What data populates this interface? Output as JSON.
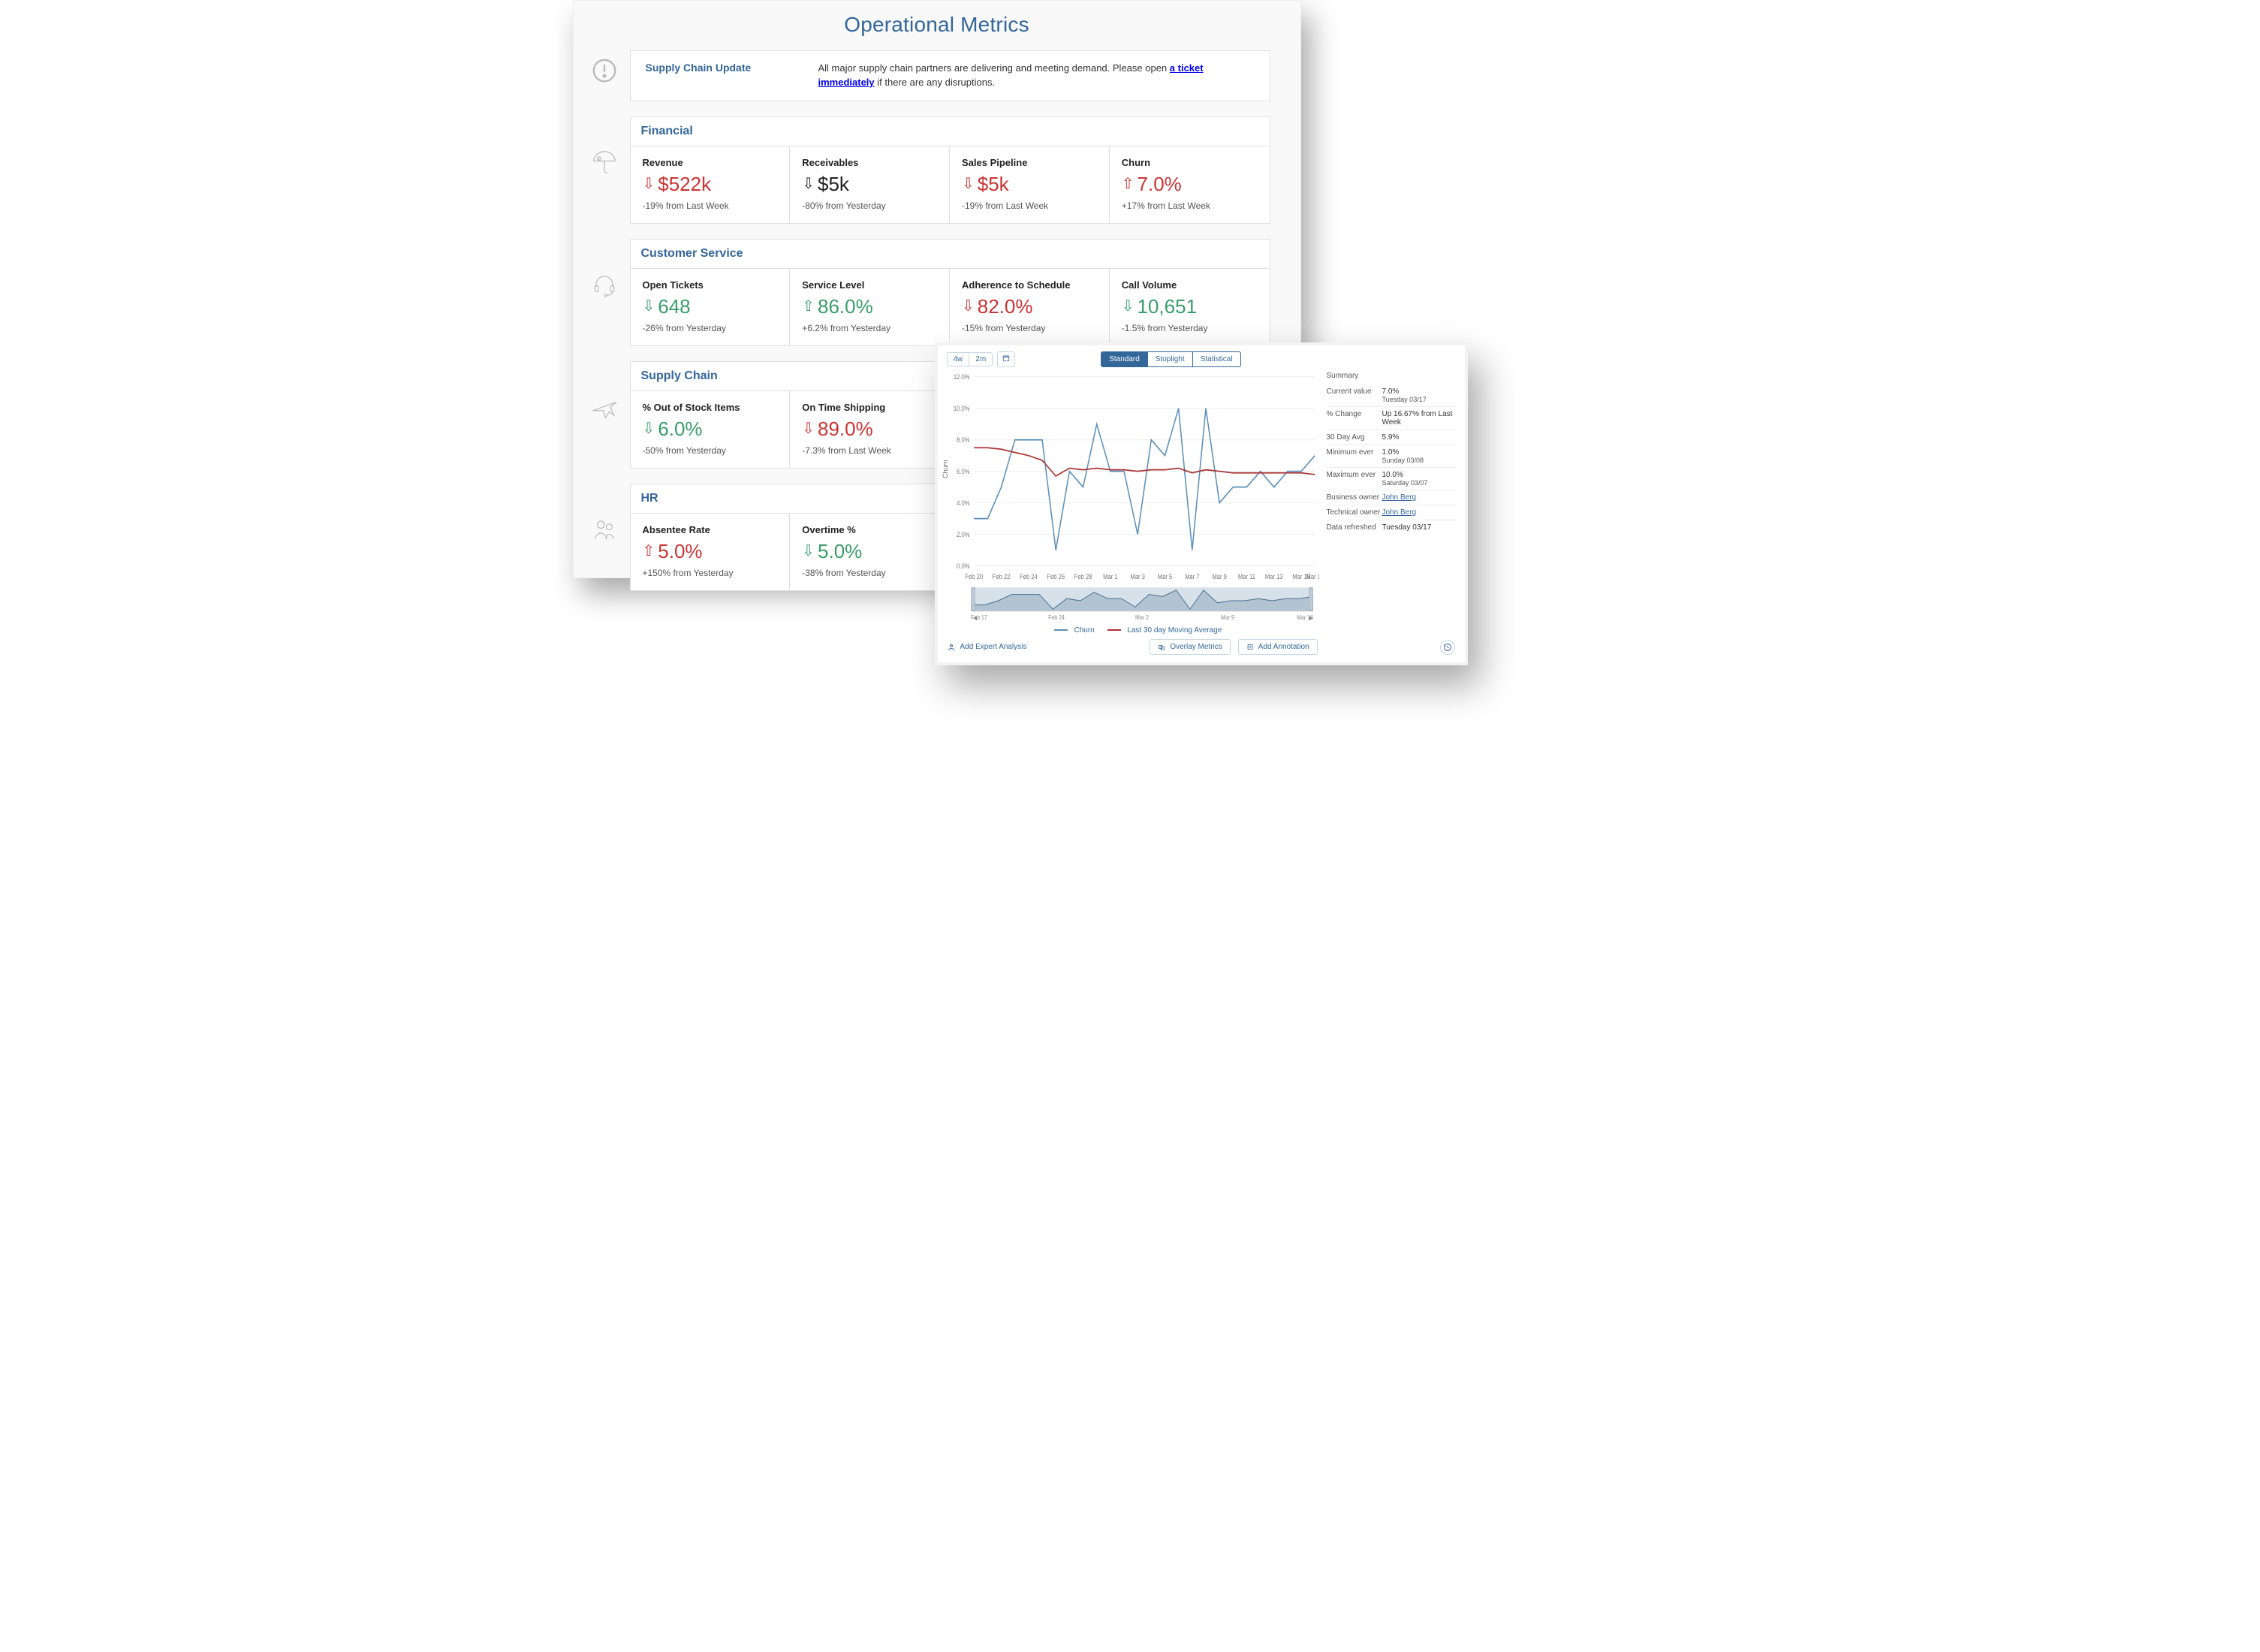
{
  "dashboard": {
    "title": "Operational Metrics",
    "notice": {
      "title": "Supply Chain Update",
      "body_prefix": "All major supply chain partners are delivering and meeting demand. Please open ",
      "link_text": "a ticket immediately",
      "body_suffix": " if there are any disruptions."
    },
    "sections": [
      {
        "id": "financial",
        "title": "Financial",
        "icon": "umbrella-dollar-icon",
        "metrics": [
          {
            "label": "Revenue",
            "value": "$522k",
            "direction": "down",
            "color": "red",
            "delta": "-19% from Last Week"
          },
          {
            "label": "Receivables",
            "value": "$5k",
            "direction": "down",
            "color": "neutral",
            "delta": "-80% from Yesterday"
          },
          {
            "label": "Sales Pipeline",
            "value": "$5k",
            "direction": "down",
            "color": "red",
            "delta": "-19% from Last Week"
          },
          {
            "label": "Churn",
            "value": "7.0%",
            "direction": "up",
            "color": "red",
            "delta": "+17% from Last Week"
          }
        ]
      },
      {
        "id": "customer-service",
        "title": "Customer Service",
        "icon": "headset-icon",
        "metrics": [
          {
            "label": "Open Tickets",
            "value": "648",
            "direction": "down",
            "color": "green",
            "delta": "-26% from Yesterday"
          },
          {
            "label": "Service Level",
            "value": "86.0%",
            "direction": "up",
            "color": "green",
            "delta": "+6.2% from Yesterday"
          },
          {
            "label": "Adherence to Schedule",
            "value": "82.0%",
            "direction": "down",
            "color": "red",
            "delta": "-15% from Yesterday"
          },
          {
            "label": "Call Volume",
            "value": "10,651",
            "direction": "down",
            "color": "green",
            "delta": "-1.5% from Yesterday"
          }
        ]
      },
      {
        "id": "supply-chain",
        "title": "Supply Chain",
        "icon": "airplane-icon",
        "metrics": [
          {
            "label": "% Out of Stock Items",
            "value": "6.0%",
            "direction": "down",
            "color": "green",
            "delta": "-50% from Yesterday"
          },
          {
            "label": "On Time Shipping",
            "value": "89.0%",
            "direction": "down",
            "color": "red",
            "delta": "-7.3% from Last Week"
          }
        ]
      },
      {
        "id": "hr",
        "title": "HR",
        "icon": "people-icon",
        "metrics": [
          {
            "label": "Absentee Rate",
            "value": "5.0%",
            "direction": "up",
            "color": "red",
            "delta": "+150% from Yesterday"
          },
          {
            "label": "Overtime %",
            "value": "5.0%",
            "direction": "down",
            "color": "green",
            "delta": "-38% from Yesterday"
          }
        ]
      }
    ]
  },
  "chart_panel": {
    "range_buttons": [
      "4w",
      "2m"
    ],
    "calendar_icon": "calendar-icon",
    "view_tabs": {
      "active": "Standard",
      "options": [
        "Standard",
        "Stoplight",
        "Statistical"
      ]
    },
    "ylabel": "Churn",
    "legend": {
      "series1": "Churn",
      "series2": "Last 30 day Moving Average"
    },
    "navigator_labels": [
      "Feb 17",
      "Feb 24",
      "Mar 2",
      "Mar 9",
      "Mar 16"
    ],
    "footer": {
      "add_analysis": "Add Expert Analysis",
      "overlay_metrics": "Overlay Metrics",
      "add_annotation": "Add Annotation",
      "history_icon": "history-icon"
    },
    "summary": {
      "title": "Summary",
      "rows": [
        {
          "k": "Current value",
          "v": "7.0%",
          "sub": "Tuesday 03/17"
        },
        {
          "k": "% Change",
          "v": "Up 16.67% from Last Week",
          "sub": ""
        },
        {
          "k": "30 Day Avg",
          "v": "5.9%",
          "sub": ""
        },
        {
          "k": "Minimum ever",
          "v": "1.0%",
          "sub": "Sunday 03/08"
        },
        {
          "k": "Maximum ever",
          "v": "10.0%",
          "sub": "Saturday 03/07"
        },
        {
          "k": "Business owner",
          "v": "John Berg",
          "link": true
        },
        {
          "k": "Technical owner",
          "v": "John Berg",
          "link": true
        },
        {
          "k": "Data refreshed",
          "v": "Tuesday 03/17",
          "sub": ""
        }
      ]
    }
  },
  "chart_data": {
    "type": "line",
    "title": "",
    "xlabel": "",
    "ylabel": "Churn",
    "ylim": [
      0,
      12
    ],
    "yticks": [
      "0.0%",
      "2.0%",
      "4.0%",
      "6.0%",
      "8.0%",
      "10.0%",
      "12.0%"
    ],
    "x_tick_labels": [
      "Feb 20",
      "Feb 22",
      "Feb 24",
      "Feb 26",
      "Feb 28",
      "Mar 1",
      "Mar 3",
      "Mar 5",
      "Mar 7",
      "Mar 9",
      "Mar 11",
      "Mar 13",
      "Mar 15",
      "Mar 17"
    ],
    "x": [
      "Feb 20",
      "Feb 21",
      "Feb 22",
      "Feb 23",
      "Feb 24",
      "Feb 25",
      "Feb 26",
      "Feb 27",
      "Feb 28",
      "Mar 1",
      "Mar 2",
      "Mar 3",
      "Mar 4",
      "Mar 5",
      "Mar 6",
      "Mar 7",
      "Mar 8",
      "Mar 9",
      "Mar 10",
      "Mar 11",
      "Mar 12",
      "Mar 13",
      "Mar 14",
      "Mar 15",
      "Mar 16",
      "Mar 17"
    ],
    "series": [
      {
        "name": "Churn",
        "color": "#5b8fba",
        "values": [
          3.0,
          3.0,
          5.0,
          8.0,
          8.0,
          8.0,
          1.0,
          6.0,
          5.0,
          9.0,
          6.0,
          6.0,
          2.0,
          8.0,
          7.0,
          10.0,
          1.0,
          10.0,
          4.0,
          5.0,
          5.0,
          6.0,
          5.0,
          6.0,
          6.0,
          7.0
        ]
      },
      {
        "name": "Last 30 day Moving Average",
        "color": "#aa3333",
        "values": [
          7.5,
          7.5,
          7.4,
          7.2,
          7.0,
          6.7,
          5.7,
          6.2,
          6.1,
          6.2,
          6.1,
          6.1,
          6.0,
          6.1,
          6.1,
          6.2,
          5.9,
          6.1,
          6.0,
          5.9,
          5.9,
          5.9,
          5.9,
          5.9,
          5.9,
          5.8
        ]
      }
    ],
    "navigator_series": {
      "x": [
        "Feb 17",
        "Feb 24",
        "Mar 2",
        "Mar 9",
        "Mar 16"
      ],
      "values": [
        4,
        7,
        5,
        6,
        6
      ]
    }
  }
}
